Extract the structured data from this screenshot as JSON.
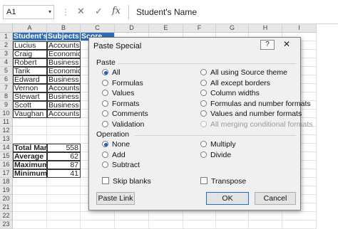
{
  "formula_bar": {
    "name_box": "A1",
    "name_box_arrow": "▾",
    "separator": "⋮",
    "cancel": "✕",
    "enter": "✓",
    "fx": "fx",
    "content": "Student's Name"
  },
  "columns": [
    "A",
    "B",
    "C",
    "D",
    "E",
    "F",
    "G",
    "H",
    "I"
  ],
  "rows": [
    "1",
    "2",
    "3",
    "4",
    "5",
    "6",
    "7",
    "8",
    "9",
    "10",
    "11",
    "12",
    "13",
    "14",
    "15",
    "16",
    "17",
    "18",
    "19",
    "20",
    "21",
    "22",
    "23"
  ],
  "table": {
    "headers": [
      "Student's Name",
      "Subjects",
      "Score"
    ],
    "names": [
      "Lucius",
      "Craig",
      "Robert",
      "Tarik",
      "Edward",
      "Vernon",
      "Stewart",
      "Scott",
      "Vaughan"
    ],
    "subjects": [
      "Accounts",
      "Economics",
      "Business",
      "Economics",
      "Business",
      "Accounts",
      "Business",
      "Business",
      "Accounts"
    ]
  },
  "summary": {
    "labels": [
      "Total Marks",
      "Average",
      "Maximum",
      "Minimum"
    ],
    "values": [
      "558",
      "62",
      "87",
      "41"
    ]
  },
  "dialog": {
    "title": "Paste Special",
    "help": "?",
    "close": "✕",
    "paste_section": "Paste",
    "paste_left": [
      "All",
      "Formulas",
      "Values",
      "Formats",
      "Comments",
      "Validation"
    ],
    "paste_right": [
      "All using Source theme",
      "All except borders",
      "Column widths",
      "Formulas and number formats",
      "Values and number formats",
      "All merging conditional formats"
    ],
    "operation_section": "Operation",
    "operation_left": [
      "None",
      "Add",
      "Subtract"
    ],
    "operation_right": [
      "Multiply",
      "Divide"
    ],
    "skip_blanks": "Skip blanks",
    "transpose": "Transpose",
    "paste_link": "Paste Link",
    "ok": "OK",
    "cancel": "Cancel"
  },
  "colors": {
    "header_fill": "#2e6db4",
    "accent": "#1c60c8"
  }
}
